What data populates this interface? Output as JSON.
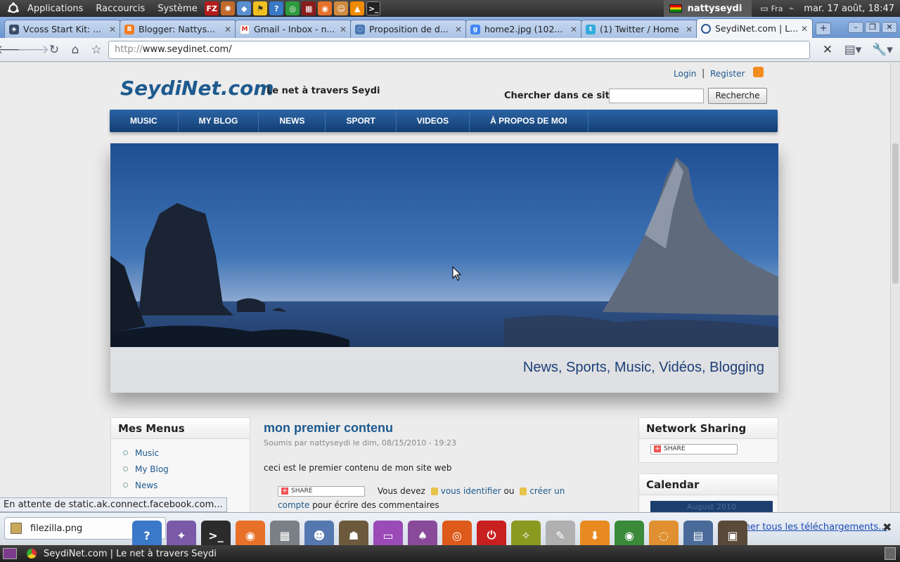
{
  "panel": {
    "menus": [
      "Applications",
      "Raccourcis",
      "Système"
    ],
    "launchers": [
      "FZ",
      "✺",
      "◆",
      "⚑",
      "?",
      "◎",
      "▦",
      "◉",
      "☺",
      "▲",
      ">_"
    ],
    "user": "nattyseydi",
    "keyboard": "Fra",
    "datetime": "mar. 17 août, 18:47"
  },
  "browser": {
    "tabs": [
      {
        "title": "Vcoss Start Kit: ...",
        "color": "#3a4a6a"
      },
      {
        "title": "Blogger: Nattys...",
        "color": "#f47b20"
      },
      {
        "title": "Gmail - Inbox - n...",
        "color": "#d93025"
      },
      {
        "title": "Proposition de d...",
        "color": "#4a78b3"
      },
      {
        "title": "home2.jpg (102...",
        "color": "#4285f4"
      },
      {
        "title": "(1) Twitter / Home",
        "color": "#33aadd"
      },
      {
        "title": "SeydiNet.com | L...",
        "color": "#2b5797"
      }
    ],
    "url_scheme": "http://",
    "url_host": "www.seydinet.com/"
  },
  "site": {
    "name": "SeydiNet.com",
    "slogan": "Le net à travers Seydi",
    "login": "Login",
    "register": "Register",
    "search_label": "Chercher dans ce site :",
    "search_value": "",
    "search_button": "Recherche",
    "nav": [
      "MUSIC",
      "MY BLOG",
      "NEWS",
      "SPORT",
      "VIDEOS",
      "À PROPOS DE MOI"
    ],
    "banner_caption": "News, Sports, Music, Vidéos, Blogging",
    "sidebar": {
      "title": "Mes Menus",
      "items": [
        "Music",
        "My Blog",
        "News"
      ]
    },
    "node": {
      "title": "mon premier contenu",
      "meta": "Soumis par nattyseydi le dim, 08/15/2010 - 19:23",
      "body": "ceci est le premier contenu de mon site web",
      "share": "SHARE",
      "you_must": "Vous devez",
      "login_link": "vous identifier",
      "or": "ou",
      "register_link": "créer un compte",
      "post_comments": "pour écrire des commentaires"
    },
    "network_sharing": {
      "title": "Network Sharing",
      "share": "SHARE"
    },
    "calendar": {
      "title": "Calendar",
      "month": "August 2010"
    }
  },
  "status": {
    "text": "En attente de static.ak.connect.facebook.com..."
  },
  "downloads": {
    "item": "filezilla.png",
    "show_all": "Afficher tous les téléchargements..."
  },
  "dock": [
    {
      "name": "help",
      "glyph": "?",
      "color": "#3a78c8"
    },
    {
      "name": "shutter",
      "glyph": "✦",
      "color": "#7a5aa8"
    },
    {
      "name": "terminal",
      "glyph": ">_",
      "color": "#2b2b2b"
    },
    {
      "name": "firefox",
      "glyph": "◉",
      "color": "#e8712a"
    },
    {
      "name": "calculator",
      "glyph": "▦",
      "color": "#7b7f86"
    },
    {
      "name": "pidgin",
      "glyph": "☻",
      "color": "#5678b0"
    },
    {
      "name": "gimp",
      "glyph": "☗",
      "color": "#6d5a3c"
    },
    {
      "name": "window",
      "glyph": "▭",
      "color": "#9a4bb6"
    },
    {
      "name": "games",
      "glyph": "♠",
      "color": "#8a4a9a"
    },
    {
      "name": "ubuntu",
      "glyph": "◎",
      "color": "#dd5a1a"
    },
    {
      "name": "power",
      "glyph": "⏻",
      "color": "#c82020"
    },
    {
      "name": "photos",
      "glyph": "✧",
      "color": "#8a9a20"
    },
    {
      "name": "editor",
      "glyph": "✎",
      "color": "#b0b0b0"
    },
    {
      "name": "downloads",
      "glyph": "⬇",
      "color": "#e88a20"
    },
    {
      "name": "chrome",
      "glyph": "◉",
      "color": "#3a8a3a"
    },
    {
      "name": "nautilus",
      "glyph": "◌",
      "color": "#e09030"
    },
    {
      "name": "screenshot",
      "glyph": "▤",
      "color": "#4a6a9a"
    },
    {
      "name": "archive",
      "glyph": "▣",
      "color": "#5a4a3a"
    }
  ],
  "taskbar": {
    "task": "SeydiNet.com | Le net à travers Seydi"
  }
}
